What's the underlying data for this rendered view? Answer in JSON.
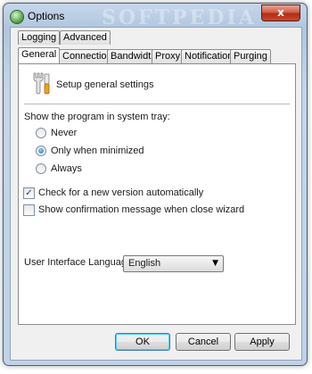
{
  "window": {
    "title": "Options",
    "watermark": "SOFTPEDIA",
    "close_label": "x"
  },
  "tabs_row1": [
    {
      "label": "Logging"
    },
    {
      "label": "Advanced"
    }
  ],
  "tabs_row2": [
    {
      "label": "General",
      "active": true
    },
    {
      "label": "Connection"
    },
    {
      "label": "Bandwidth"
    },
    {
      "label": "Proxy"
    },
    {
      "label": "Notification"
    },
    {
      "label": "Purging"
    }
  ],
  "general": {
    "header": "Setup general settings",
    "tray_label": "Show the program in system tray:",
    "tray_options": [
      {
        "label": "Never",
        "selected": false
      },
      {
        "label": "Only when minimized",
        "selected": true
      },
      {
        "label": "Always",
        "selected": false
      }
    ],
    "check_updates": {
      "label": "Check for a new version automatically",
      "checked": true
    },
    "confirm_close": {
      "label": "Show confirmation message when close wizard",
      "checked": false
    },
    "language": {
      "label": "User Interface Language:",
      "value": "English"
    }
  },
  "buttons": {
    "ok": "OK",
    "cancel": "Cancel",
    "apply": "Apply"
  }
}
